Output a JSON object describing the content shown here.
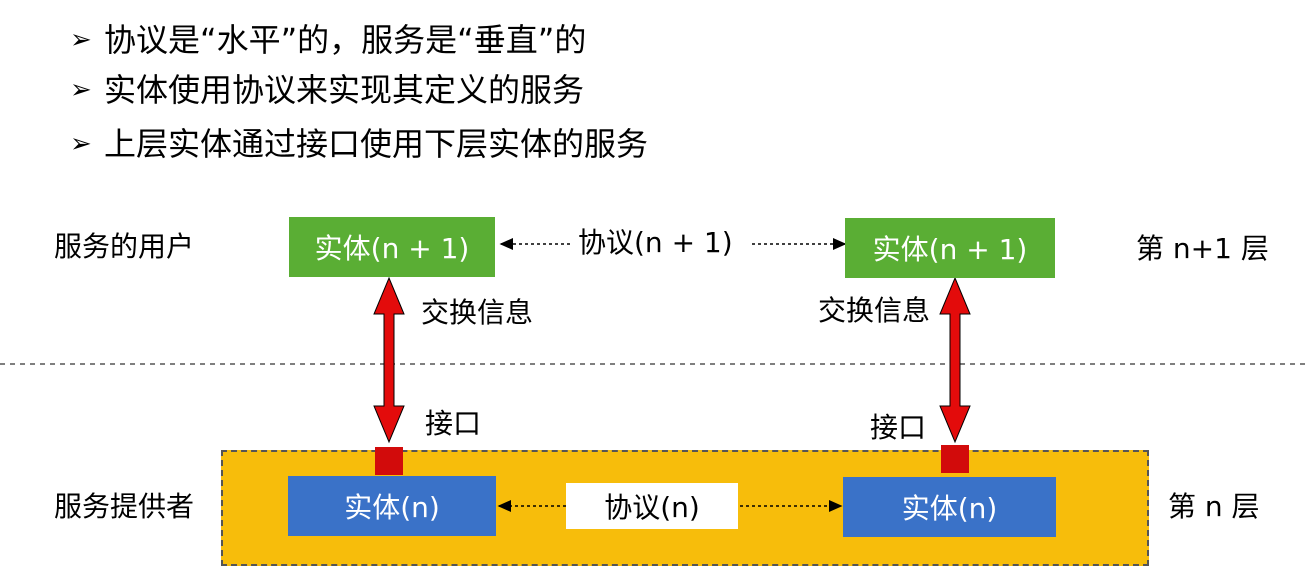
{
  "bullets": [
    {
      "marker": "➢",
      "text": "协议是“水平”的，服务是“垂直”的"
    },
    {
      "marker": "➢",
      "text": "实体使用协议来实现其定义的服务"
    },
    {
      "marker": "➢",
      "text": "上层实体通过接口使用下层实体的服务"
    }
  ],
  "labels": {
    "service_user": "服务的用户",
    "service_provider": "服务提供者",
    "layer_upper": "第 n+1 层",
    "layer_lower": "第 n 层",
    "exchange_left": "交换信息",
    "exchange_right": "交换信息",
    "interface_left": "接口",
    "interface_right": "接口"
  },
  "entities": {
    "upper_left": "实体(n + 1)",
    "upper_right": "实体(n + 1)",
    "lower_left": "实体(n)",
    "lower_right": "实体(n)"
  },
  "protocols": {
    "upper": "协议(n + 1)",
    "lower": "协议(n)"
  },
  "colors": {
    "entity_upper": "#5aae34",
    "entity_lower": "#3a72c8",
    "provider_area": "#f7bd0b",
    "interface": "#d20b0b",
    "arrow": "#e30b0b"
  }
}
